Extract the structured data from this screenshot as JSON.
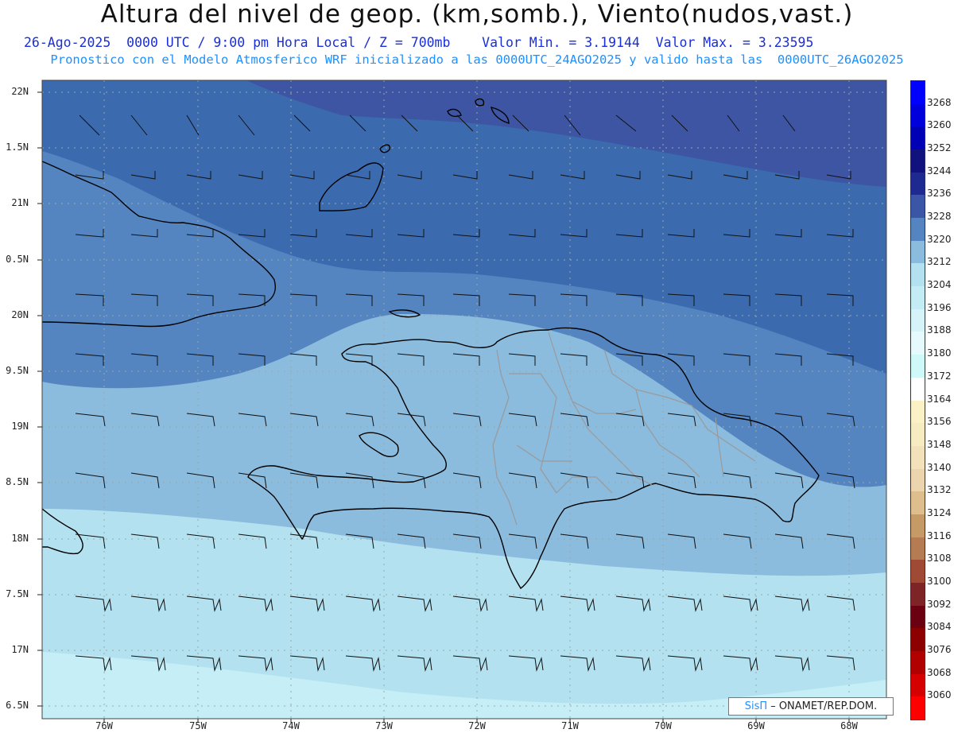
{
  "header": {
    "title": "Altura del nivel de geop. (km,somb.), Viento(nudos,vast.)",
    "line1": "26-Ago-2025  0000 UTC / 9:00 pm Hora Local / Z = 700mb    Valor Min. = 3.19144  Valor Max. = 3.23595",
    "line2": "Pronostico con el Modelo Atmosferico WRF inicializado a las 0000UTC_24AGO2025 y valido hasta las  0000UTC_26AGO2025"
  },
  "credit": {
    "brand": "SisΠ",
    "text": "– ONAMET/REP.DOM."
  },
  "axes": {
    "lat_labels": [
      "22N",
      "1.5N",
      "21N",
      "0.5N",
      "20N",
      "9.5N",
      "19N",
      "8.5N",
      "18N",
      "7.5N",
      "17N",
      "6.5N"
    ],
    "lon_labels": [
      "76W",
      "75W",
      "74W",
      "73W",
      "72W",
      "71W",
      "70W",
      "69W",
      "68W"
    ]
  },
  "legend": {
    "labels": [
      "3268",
      "3260",
      "3252",
      "3244",
      "3236",
      "3228",
      "3220",
      "3212",
      "3204",
      "3196",
      "3188",
      "3180",
      "3172",
      "3164",
      "3156",
      "3148",
      "3140",
      "3132",
      "3124",
      "3116",
      "3108",
      "3100",
      "3092",
      "3084",
      "3076",
      "3068",
      "3060"
    ],
    "colors": [
      "#0000ff",
      "#0000dd",
      "#0000b5",
      "#12127f",
      "#1e2a8f",
      "#3b56a6",
      "#5485c0",
      "#8bbbdd",
      "#b3e1ef",
      "#c3ecf5",
      "#d5f3f9",
      "#e6f9fc",
      "#cff8f8",
      "#ffffff",
      "#fbf1c7",
      "#f7ebc2",
      "#f2e1ba",
      "#ecd5ae",
      "#ddbe8c",
      "#c69a66",
      "#b57b52",
      "#a04a36",
      "#7e2427",
      "#6b0010",
      "#8d0000",
      "#b10000",
      "#d70000",
      "#ff0000"
    ]
  },
  "map": {
    "region": "Hispaniola / Cuba oriental / Bahamas",
    "shading_levels": [
      "3228",
      "3220",
      "3212",
      "3204",
      "3196"
    ]
  }
}
